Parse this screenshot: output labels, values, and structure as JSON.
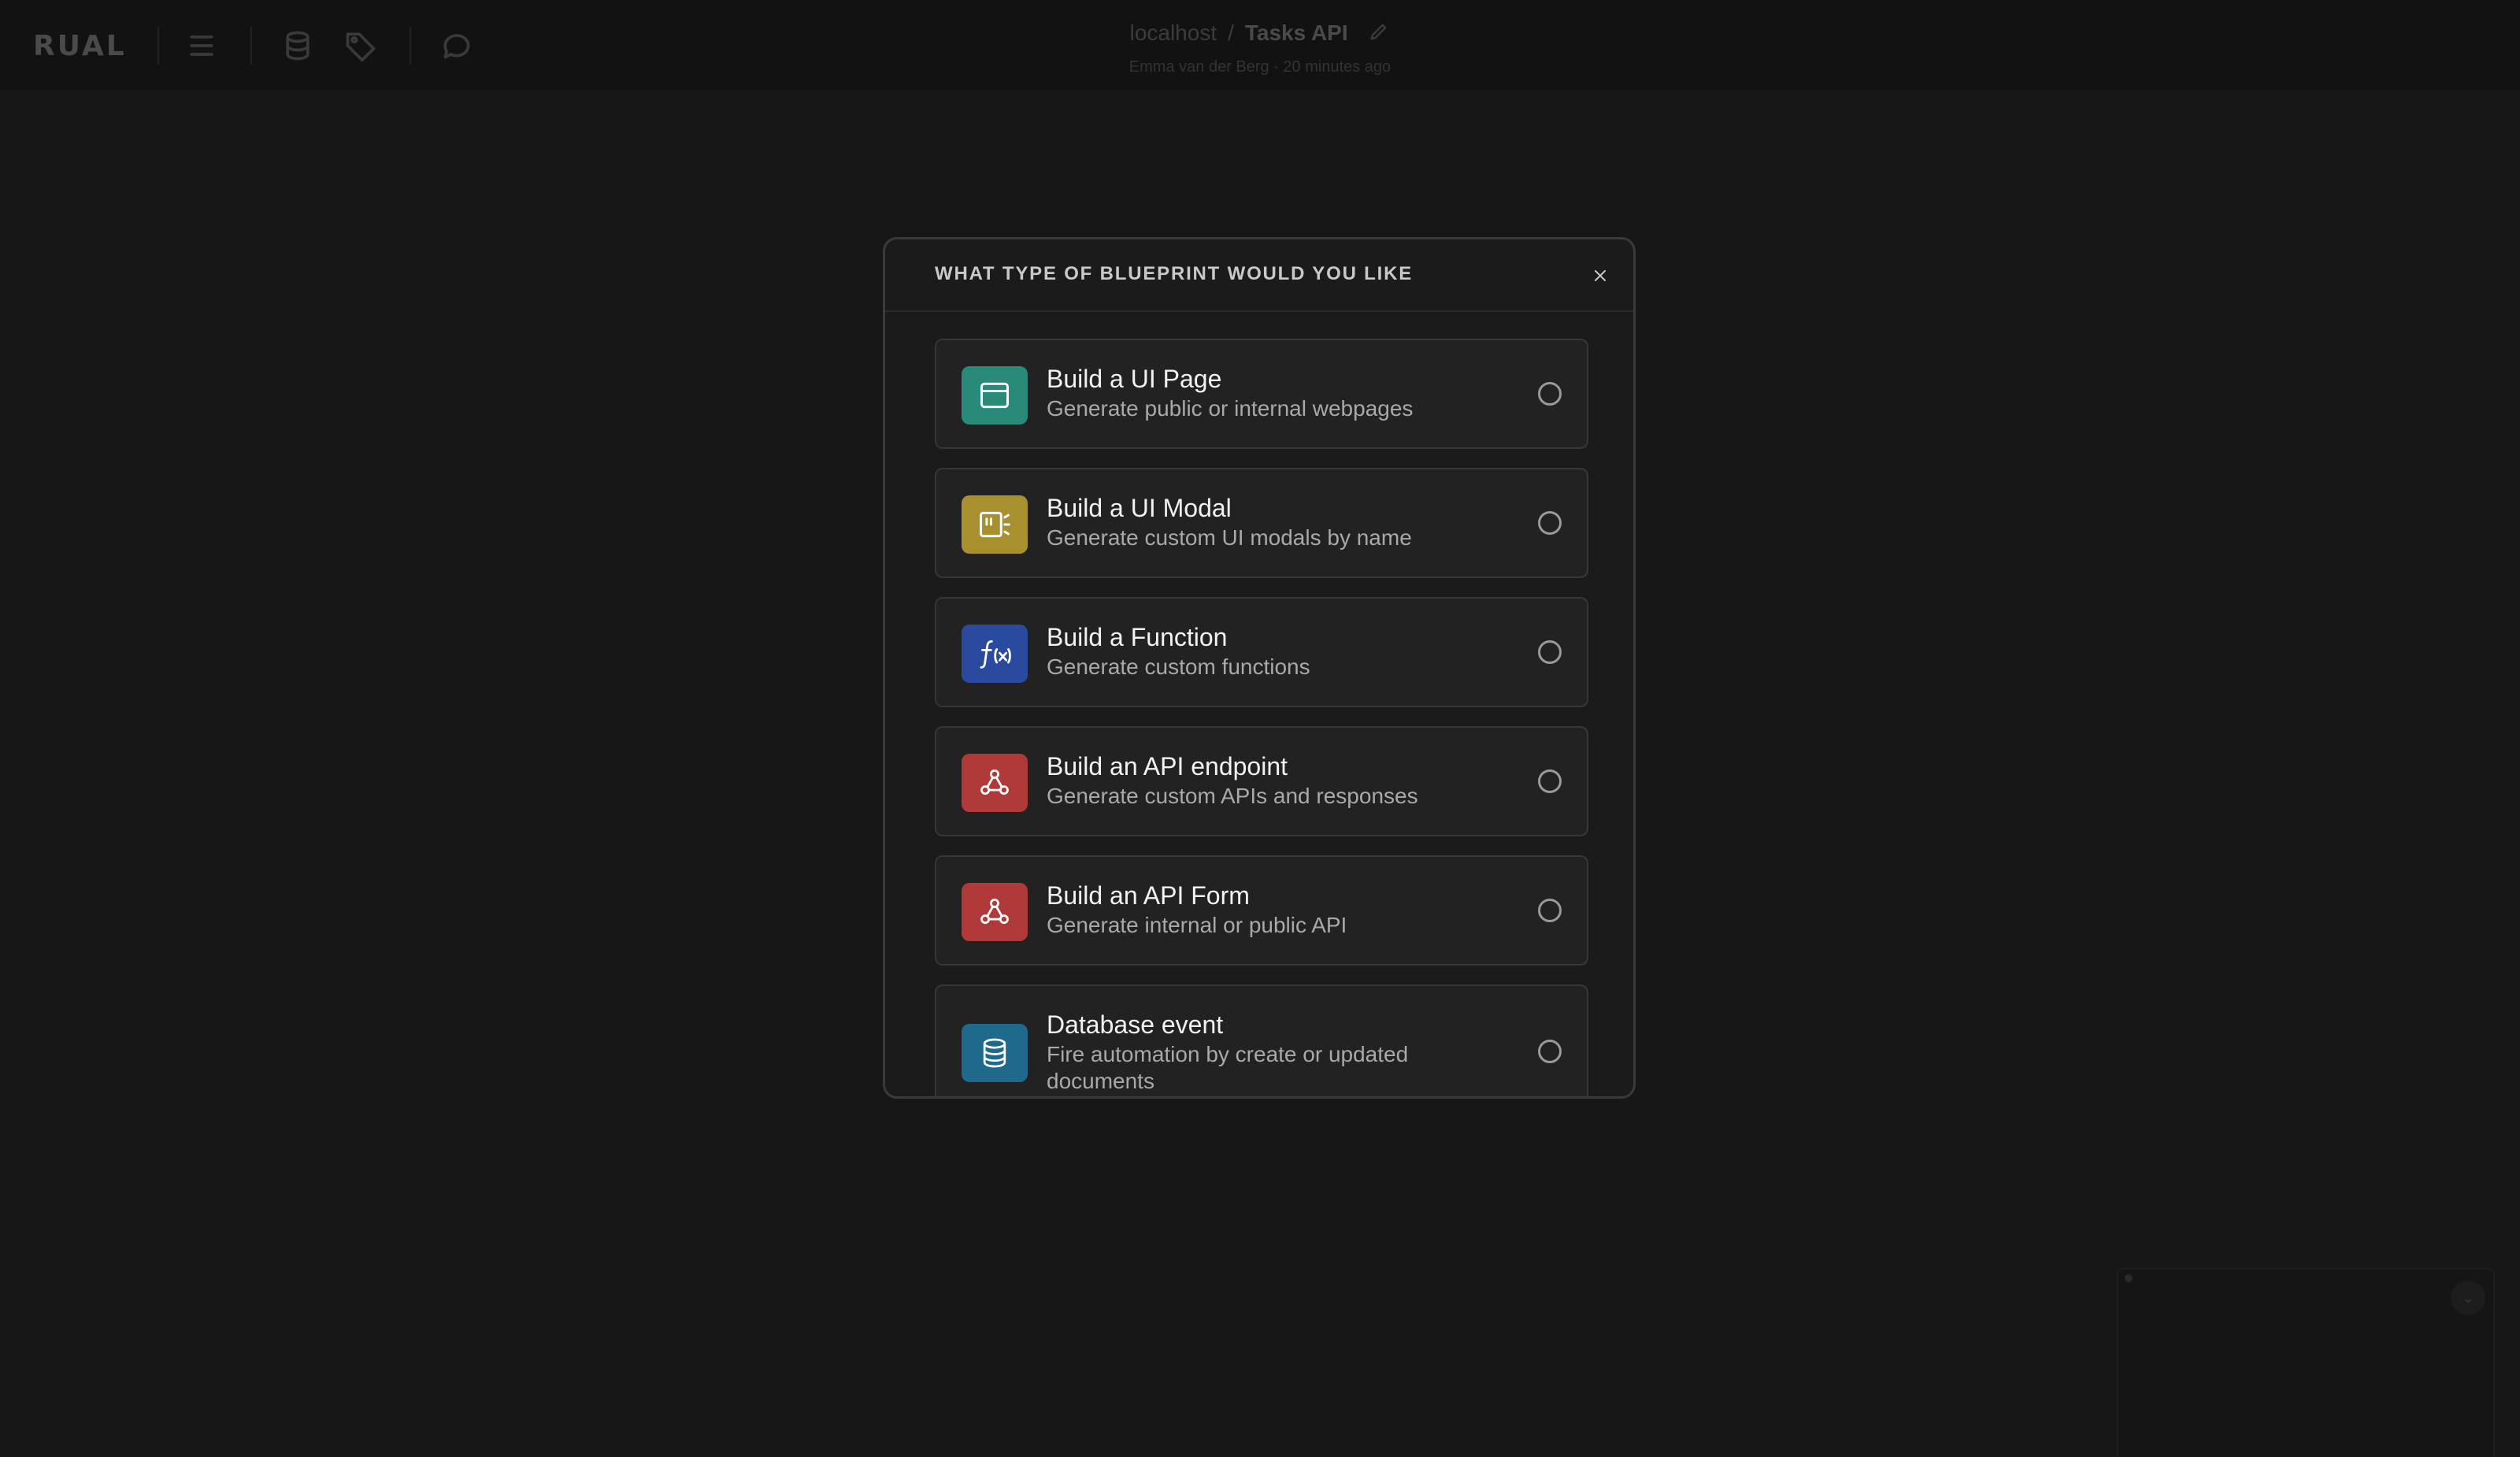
{
  "app": {
    "logo": "RUAL",
    "breadcrumb": {
      "host": "localhost",
      "separator": "/",
      "project": "Tasks API"
    },
    "subline": "Emma van der Berg · 20 minutes ago"
  },
  "modal": {
    "title": "WHAT TYPE OF BLUEPRINT WOULD YOU LIKE",
    "close_icon": "close-icon",
    "options": [
      {
        "title": "Build a UI Page",
        "description": "Generate public or internal webpages",
        "icon": "browser-window-icon",
        "color": "#2a8a7a",
        "selected": false
      },
      {
        "title": "Build a UI Modal",
        "description": "Generate custom UI modals by name",
        "icon": "modal-icon",
        "color": "#a8902e",
        "selected": false
      },
      {
        "title": "Build a Function",
        "description": "Generate custom functions",
        "icon": "function-icon",
        "color": "#2a4aa0",
        "selected": false
      },
      {
        "title": "Build an API endpoint",
        "description": "Generate custom APIs and responses",
        "icon": "webhook-icon",
        "color": "#b03a3a",
        "selected": false
      },
      {
        "title": "Build an API Form",
        "description": "Generate internal or public API",
        "icon": "webhook-icon",
        "color": "#b03a3a",
        "selected": false
      },
      {
        "title": "Database event",
        "description": "Fire automation by create or updated documents",
        "icon": "database-icon",
        "color": "#1f6a8c",
        "selected": false
      }
    ]
  },
  "colors": {
    "background": "#171717",
    "modal_bg": "#1b1b1b",
    "option_bg": "#222222"
  }
}
